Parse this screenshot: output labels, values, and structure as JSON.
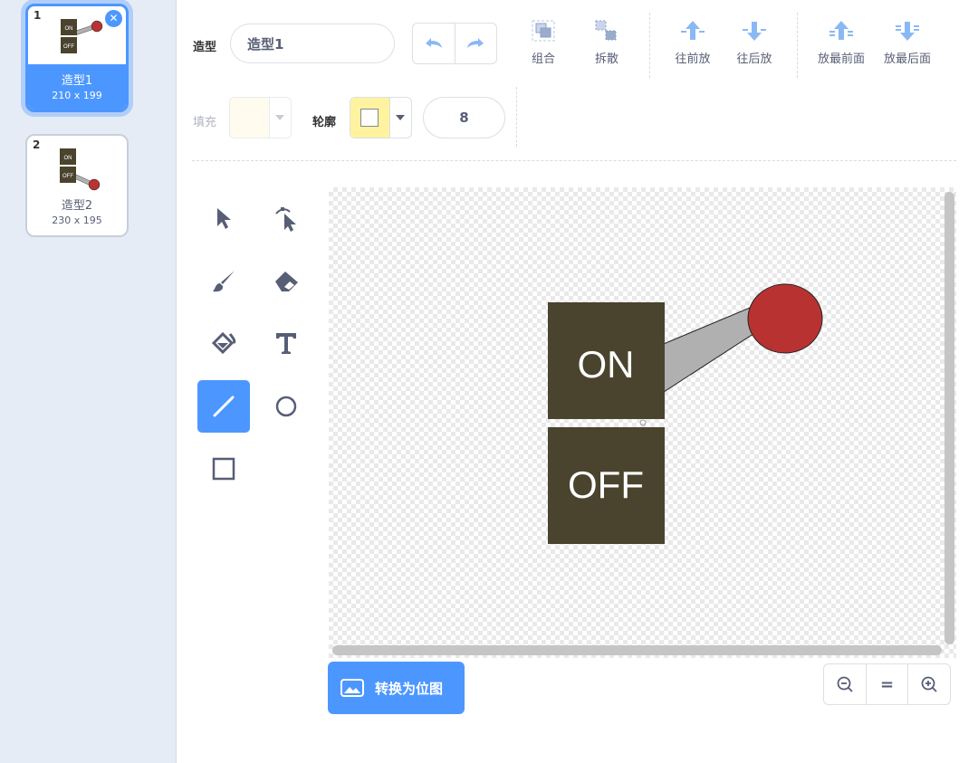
{
  "costumes": [
    {
      "number": "1",
      "name": "造型1",
      "size": "210 x 199",
      "selected": true,
      "thumb_on": "ON",
      "thumb_off": "OFF"
    },
    {
      "number": "2",
      "name": "造型2",
      "size": "230 x 195",
      "selected": false,
      "thumb_on": "ON",
      "thumb_off": "OFF"
    }
  ],
  "toolbar": {
    "costume_label": "造型",
    "costume_name": "造型1",
    "group": "组合",
    "ungroup": "拆散",
    "forward": "往前放",
    "backward": "往后放",
    "front": "放最前面",
    "back": "放最后面"
  },
  "props": {
    "fill_label": "填充",
    "outline_label": "轮廓",
    "fill_color": "#fffbe5",
    "outline_color": "#fff3a0",
    "stroke_width": "8"
  },
  "tools": [
    {
      "name": "select",
      "icon": "arrow-select-icon",
      "active": false
    },
    {
      "name": "reshape",
      "icon": "reshape-icon",
      "active": false
    },
    {
      "name": "brush",
      "icon": "brush-icon",
      "active": false
    },
    {
      "name": "eraser",
      "icon": "eraser-icon",
      "active": false
    },
    {
      "name": "fill",
      "icon": "fill-bucket-icon",
      "active": false
    },
    {
      "name": "text",
      "icon": "text-icon",
      "active": false
    },
    {
      "name": "line",
      "icon": "line-icon",
      "active": true
    },
    {
      "name": "circle",
      "icon": "circle-icon",
      "active": false
    },
    {
      "name": "rectangle",
      "icon": "rectangle-icon",
      "active": false
    }
  ],
  "drawing": {
    "on_text": "ON",
    "off_text": "OFF",
    "box_color": "#4a432e",
    "knob_color": "#b83232",
    "lever_color": "#b0b0b0"
  },
  "bottom": {
    "convert_label": "转换为位图",
    "zoom_out": "zoom-out-icon",
    "zoom_reset": "=",
    "zoom_in": "zoom-in-icon"
  },
  "accent": "#4c97ff"
}
